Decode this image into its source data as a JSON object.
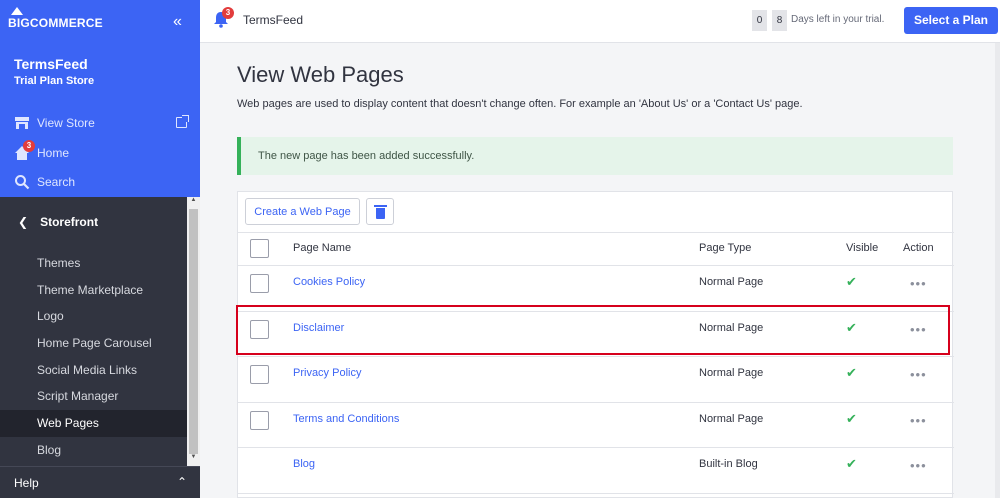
{
  "brand": {
    "logo_text": "BIGCOMMERCE",
    "accent": "#3c64f4"
  },
  "sidebar": {
    "store_name": "TermsFeed",
    "store_plan": "Trial Plan Store",
    "top_items": [
      {
        "label": "View Store",
        "icon": "store-icon"
      },
      {
        "label": "Home",
        "icon": "home-icon",
        "badge": "3"
      },
      {
        "label": "Search",
        "icon": "search-icon"
      }
    ],
    "section": "Storefront",
    "sub_items": [
      {
        "label": "Themes",
        "active": false
      },
      {
        "label": "Theme Marketplace",
        "active": false
      },
      {
        "label": "Logo",
        "active": false
      },
      {
        "label": "Home Page Carousel",
        "active": false
      },
      {
        "label": "Social Media Links",
        "active": false
      },
      {
        "label": "Script Manager",
        "active": false
      },
      {
        "label": "Web Pages",
        "active": true
      },
      {
        "label": "Blog",
        "active": false
      }
    ],
    "help": "Help"
  },
  "topbar": {
    "notification_count": "3",
    "store": "TermsFeed",
    "trial_digits": [
      "0",
      "8"
    ],
    "trial_text": "Days left in your trial.",
    "plan_button": "Select a Plan"
  },
  "main": {
    "title": "View Web Pages",
    "description": "Web pages are used to display content that doesn't change often. For example an 'About Us' or a 'Contact Us' page.",
    "alert": "The new page has been added successfully.",
    "create_button": "Create a Web Page",
    "columns": {
      "name": "Page Name",
      "type": "Page Type",
      "visible": "Visible",
      "action": "Action"
    },
    "rows": [
      {
        "name": "Cookies Policy",
        "type": "Normal Page",
        "visible": "✔",
        "action": "•••"
      },
      {
        "name": "Disclaimer",
        "type": "Normal Page",
        "visible": "✔",
        "action": "•••"
      },
      {
        "name": "Privacy Policy",
        "type": "Normal Page",
        "visible": "✔",
        "action": "•••"
      },
      {
        "name": "Terms and Conditions",
        "type": "Normal Page",
        "visible": "✔",
        "action": "•••"
      },
      {
        "name": "Blog",
        "type": "Built-in Blog",
        "visible": "✔",
        "action": "•••"
      }
    ]
  }
}
